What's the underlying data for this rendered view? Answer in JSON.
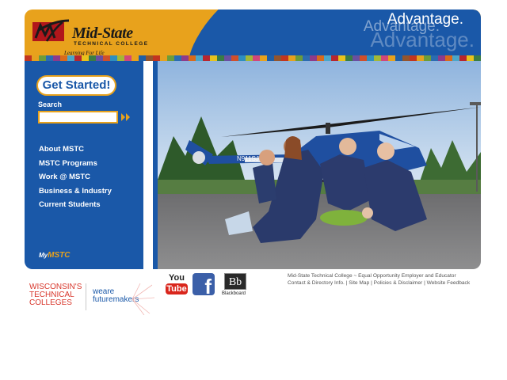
{
  "header": {
    "brand_name": "Mid-State",
    "brand_sub": "TECHNICAL COLLEGE",
    "tagline": "Learning For Life",
    "advantage_1": "Advantage.",
    "advantage_2": "Advantage.",
    "advantage_3": "Advantage."
  },
  "colors": {
    "gold": "#e8a21c",
    "blue": "#1a58a8",
    "logo_red": "#b1161b",
    "strip": [
      "#c2351f",
      "#e5a11e",
      "#6c9c3a",
      "#2b6cb0",
      "#8e3b8a",
      "#d96a1b",
      "#4aa6c9",
      "#b7262f",
      "#e8c21c",
      "#3a7d44",
      "#6a4fa0",
      "#cf4f2b",
      "#2e8fbf",
      "#a3b837",
      "#d1477a",
      "#e8a21c",
      "#1f5fa6",
      "#93552e"
    ]
  },
  "nav": {
    "get_started": "Get Started!",
    "search_label": "Search",
    "search_value": "",
    "items": [
      {
        "label": "About MSTC"
      },
      {
        "label": "MSTC Programs"
      },
      {
        "label": "Work @ MSTC"
      },
      {
        "label": "Business & Industry"
      },
      {
        "label": "Current Students"
      }
    ],
    "mymstc": {
      "my": "My",
      "mstc": "MSTC"
    }
  },
  "photo": {
    "tail_text": "N911SJ",
    "alt_icon": "helicopter-training-photo"
  },
  "footer": {
    "wtc_1": "WISCONSIN'S",
    "wtc_2": "TECHNICAL",
    "wtc_3": "COLLEGES",
    "we_are_1": "weare",
    "we_are_2": "futuremakers",
    "youtube_you": "You",
    "youtube_tube": "Tube",
    "facebook": "f",
    "blackboard_mark": "Bb",
    "blackboard_label": "Blackboard",
    "line1": "Mid-State Technical College ~ Equal Opportunity Employer and Educator",
    "links": [
      "Contact & Directory Info.",
      "Site Map",
      "Policies & Disclaimer",
      "Website Feedback"
    ],
    "separator": "|"
  }
}
